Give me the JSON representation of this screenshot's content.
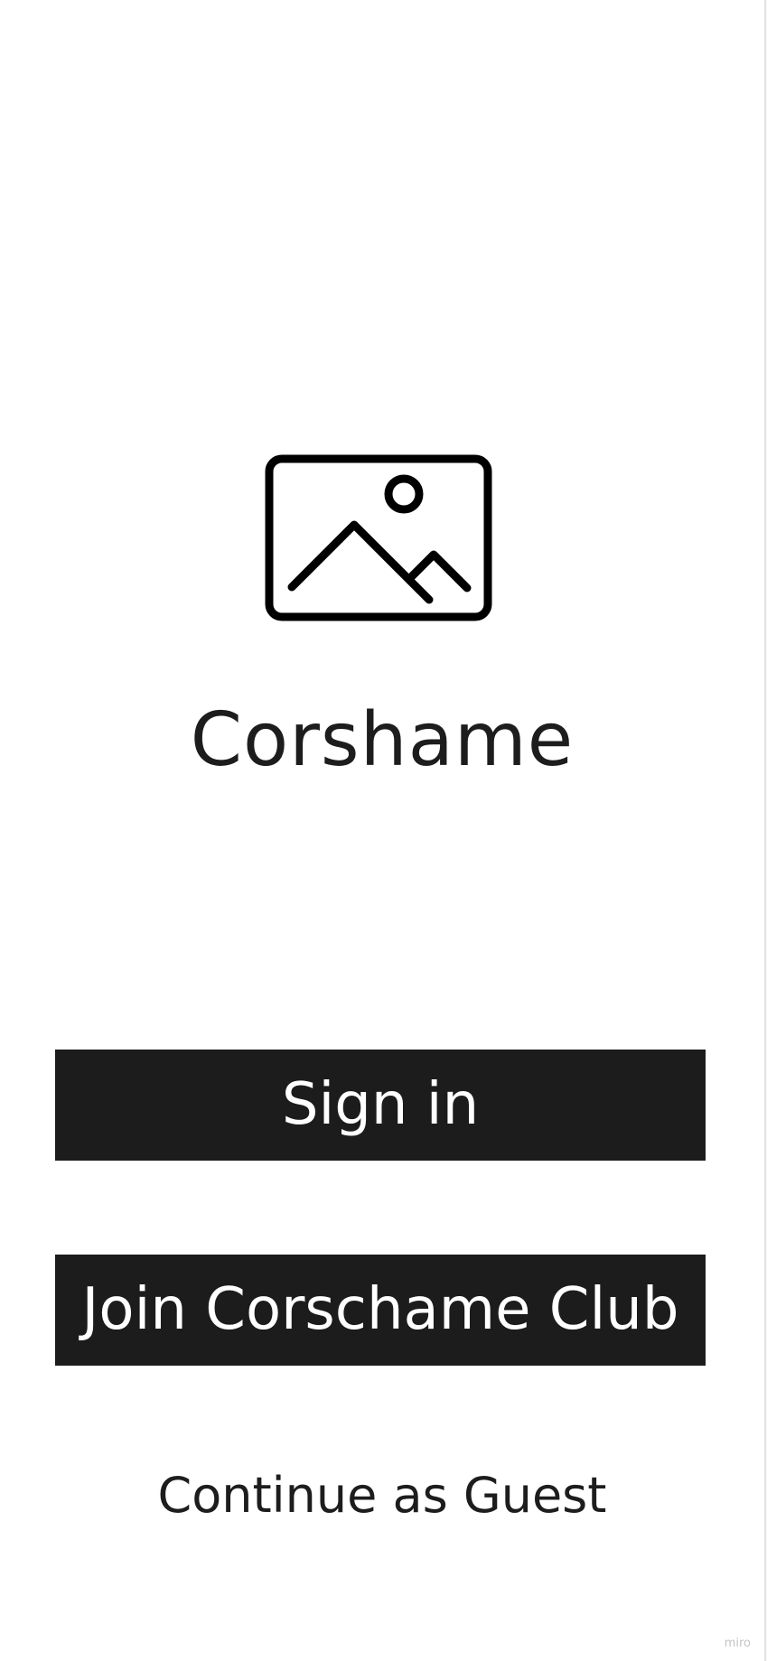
{
  "logo": {
    "icon": "image-placeholder-icon"
  },
  "app": {
    "name": "Corshame"
  },
  "actions": {
    "sign_in_label": "Sign in",
    "join_label": "Join Corschame Club",
    "guest_label": "Continue as Guest"
  },
  "watermark": {
    "text": "miro"
  },
  "colors": {
    "background": "#ffffff",
    "button_background": "#1c1c1c",
    "button_text": "#ffffff",
    "text": "#1d1d1d"
  }
}
